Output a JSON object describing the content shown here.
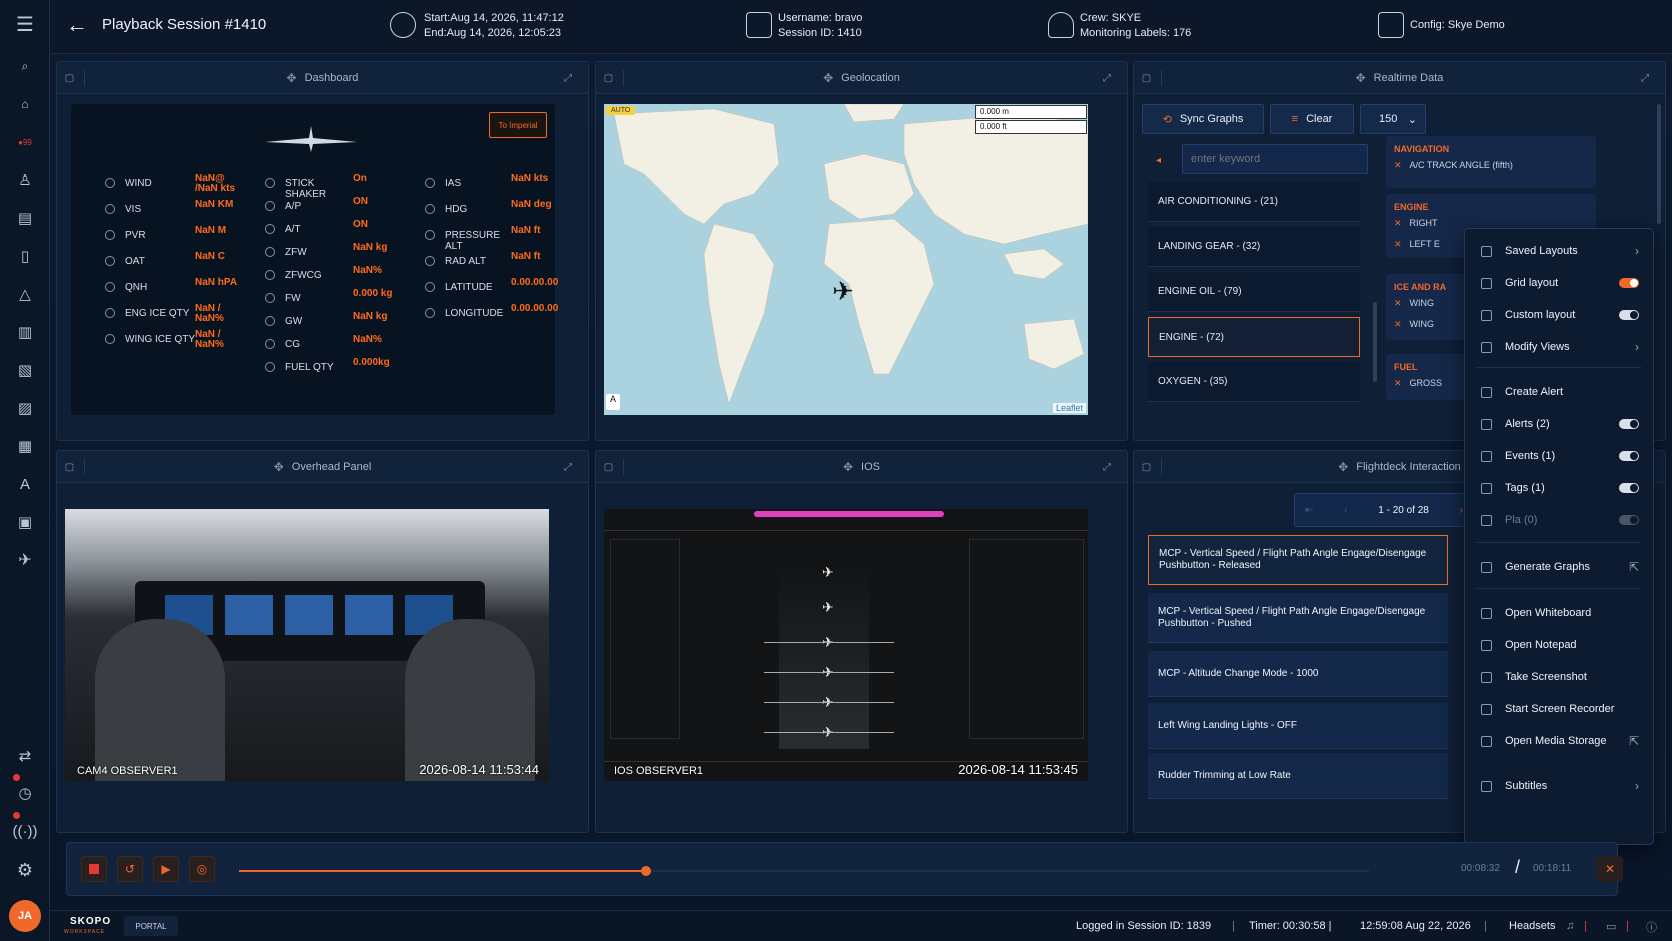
{
  "header": {
    "title": "Playback Session #1410",
    "start": "Start:Aug 14, 2026, 11:47:12",
    "end": "End:Aug 14, 2026, 12:05:23",
    "username": "Username: bravo",
    "session_id": "Session ID: 1410",
    "crew": "Crew: SKYE",
    "labels": "Monitoring Labels: 176",
    "config": "Config: Skye Demo"
  },
  "panels": {
    "dashboard": "Dashboard",
    "geolocation": "Geolocation",
    "realtime": "Realtime Data",
    "overhead": "Overhead Panel",
    "ios": "IOS",
    "flightdeck": "Flightdeck Interaction"
  },
  "dashboard": {
    "imperial_btn": "To Imperial",
    "col1": [
      {
        "label": "WIND",
        "value": "NaN@ /NaN kts"
      },
      {
        "label": "VIS",
        "value": "NaN KM"
      },
      {
        "label": "PVR",
        "value": "NaN M"
      },
      {
        "label": "OAT",
        "value": "NaN C"
      },
      {
        "label": "QNH",
        "value": "NaN hPA"
      },
      {
        "label": "ENG ICE QTY",
        "value": "NaN / NaN%"
      },
      {
        "label": "WING ICE QTY",
        "value": "NaN / NaN%"
      }
    ],
    "col2": [
      {
        "label": "STICK SHAKER",
        "value": "On"
      },
      {
        "label": "A/P",
        "value": "ON"
      },
      {
        "label": "A/T",
        "value": "ON"
      },
      {
        "label": "ZFW",
        "value": "NaN kg"
      },
      {
        "label": "ZFWCG",
        "value": "NaN%"
      },
      {
        "label": "FW",
        "value": "0.000 kg"
      },
      {
        "label": "GW",
        "value": "NaN kg"
      },
      {
        "label": "CG",
        "value": "NaN%"
      },
      {
        "label": "FUEL QTY",
        "value": "0.000kg"
      }
    ],
    "col3": [
      {
        "label": "IAS",
        "value": "NaN kts"
      },
      {
        "label": "HDG",
        "value": "NaN deg"
      },
      {
        "label": "PRESSURE ALT",
        "value": "NaN ft"
      },
      {
        "label": "RAD ALT",
        "value": "NaN ft"
      },
      {
        "label": "LATITUDE",
        "value": "0.00.00.00"
      },
      {
        "label": "LONGITUDE",
        "value": "0.00.00.00"
      }
    ]
  },
  "map": {
    "auto": "AUTO",
    "scale_m": "0.000 m",
    "scale_ft": "0.000 ft",
    "attribution": "Leaflet"
  },
  "realtime": {
    "sync": "Sync Graphs",
    "clear": "Clear",
    "count": "150",
    "search_placeholder": "enter keyword",
    "categories": [
      "AIR CONDITIONING - (21)",
      "LANDING GEAR - (32)",
      "ENGINE OIL - (79)",
      "ENGINE - (72)",
      "OXYGEN - (35)"
    ],
    "groups": [
      {
        "name": "NAVIGATION",
        "items": [
          "A/C TRACK ANGLE  (fifth)"
        ]
      },
      {
        "name": "ENGINE",
        "items": [
          "RIGHT",
          "LEFT E"
        ]
      },
      {
        "name": "ICE AND RA",
        "items": [
          "WING",
          "WING"
        ]
      },
      {
        "name": "FUEL",
        "items": [
          "GROSS"
        ]
      }
    ]
  },
  "video": {
    "overhead_cam": "CAM4 OBSERVER1",
    "overhead_time": "2026-08-14  11:53:44",
    "ios_cam": "IOS OBSERVER1",
    "ios_time": "2026-08-14  11:53:45"
  },
  "flightdeck": {
    "pager": "1 - 20 of 28",
    "items": [
      "MCP - Vertical Speed / Flight Path Angle Engage/Disengage Pushbutton - Released",
      "MCP - Vertical Speed / Flight Path Angle Engage/Disengage Pushbutton - Pushed",
      "MCP - Altitude Change Mode - 1000",
      "Left Wing Landing Lights - OFF",
      "Rudder Trimming at Low Rate"
    ]
  },
  "menu": {
    "items": [
      "Saved Layouts",
      "Grid layout",
      "Custom layout",
      "Modify Views",
      "Create Alert",
      "Alerts (2)",
      "Events (1)",
      "Tags (1)",
      "Pla (0)",
      "Generate Graphs",
      "Open Whiteboard",
      "Open Notepad",
      "Take Screenshot",
      "Start Screen Recorder",
      "Open Media Storage",
      "Subtitles"
    ]
  },
  "player": {
    "current": "00:08:32",
    "sep": "/",
    "total": "00:18:11",
    "progress": 0.36
  },
  "footer": {
    "brand": "SKOPO",
    "brand_sub": "WORKSPACE",
    "portal": "PORTAL",
    "session": "Logged in Session ID:  1839",
    "timer": "Timer:  00:30:58 |",
    "clock": "12:59:08  Aug 22, 2026",
    "headsets": "Headsets"
  },
  "user": {
    "initials": "JA"
  },
  "colors": {
    "accent": "#f0692a",
    "bg": "#0a1628",
    "panel": "#0f1f36"
  }
}
